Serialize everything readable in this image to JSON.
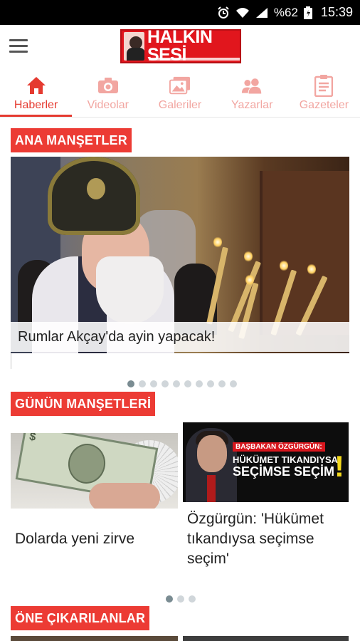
{
  "status_bar": {
    "battery_percent": "%62",
    "time": "15:39",
    "icons": [
      "alarm-icon",
      "wifi-icon",
      "signal-icon",
      "battery-icon"
    ]
  },
  "app_bar": {
    "logo_text": "HALKIN SESİ"
  },
  "tabs": [
    {
      "label": "Haberler",
      "icon": "home-icon",
      "active": true
    },
    {
      "label": "Videolar",
      "icon": "camera-icon",
      "active": false
    },
    {
      "label": "Galeriler",
      "icon": "gallery-icon",
      "active": false
    },
    {
      "label": "Yazarlar",
      "icon": "people-icon",
      "active": false
    },
    {
      "label": "Gazeteler",
      "icon": "clipboard-icon",
      "active": false
    }
  ],
  "sections": {
    "headlines_title": "ANA MANŞETLER",
    "daily_title": "GÜNÜN MANŞETLERİ",
    "featured_title": "ÖNE ÇIKARILANLAR"
  },
  "hero": {
    "caption": "Rumlar Akçay'da ayin yapacak!",
    "slide_count": 10,
    "active_slide": 0
  },
  "daily_cards": [
    {
      "title": "Dolarda yeni zirve"
    },
    {
      "title_lines": [
        "Özgürgün: 'Hükümet",
        "tıkandıysa seçimse",
        "seçim'"
      ],
      "image_kicker": "BAŞBAKAN ÖZGÜRGÜN:",
      "image_headline_1": "HÜKÜMET TIKANDIYSA",
      "image_headline_2": "SEÇİMSE SEÇİM",
      "image_exclamation": "!"
    }
  ],
  "daily_pager": {
    "count": 3,
    "active": 0
  },
  "colors": {
    "accent": "#ec3b34",
    "tab_inactive": "#f2a6a1",
    "dot_active": "#7a8c92",
    "dot_inactive": "#d0d6da"
  }
}
